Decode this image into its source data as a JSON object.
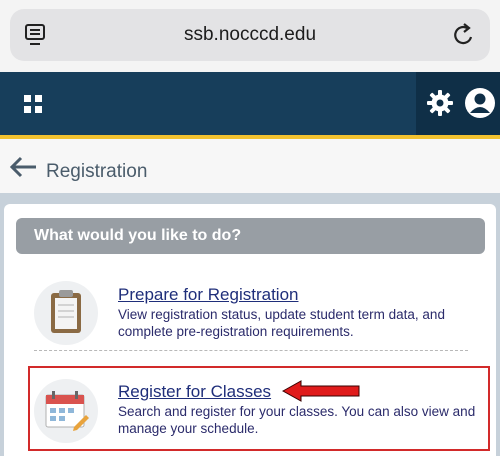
{
  "browser": {
    "url": "ssb.nocccd.edu"
  },
  "breadcrumb": {
    "title": "Registration"
  },
  "main": {
    "question": "What would you like to do?",
    "options": [
      {
        "title": "Prepare for Registration",
        "description": "View registration status, update student term data, and complete pre-registration requirements.",
        "icon": "clipboard-icon"
      },
      {
        "title": "Register for Classes",
        "description": "Search and register for your classes. You can also view and manage your schedule.",
        "icon": "calendar-icon"
      }
    ]
  },
  "colors": {
    "header": "#173e5b",
    "header_accent": "#f2c230",
    "link": "#1f2e7a",
    "highlight": "#d22a2a"
  }
}
